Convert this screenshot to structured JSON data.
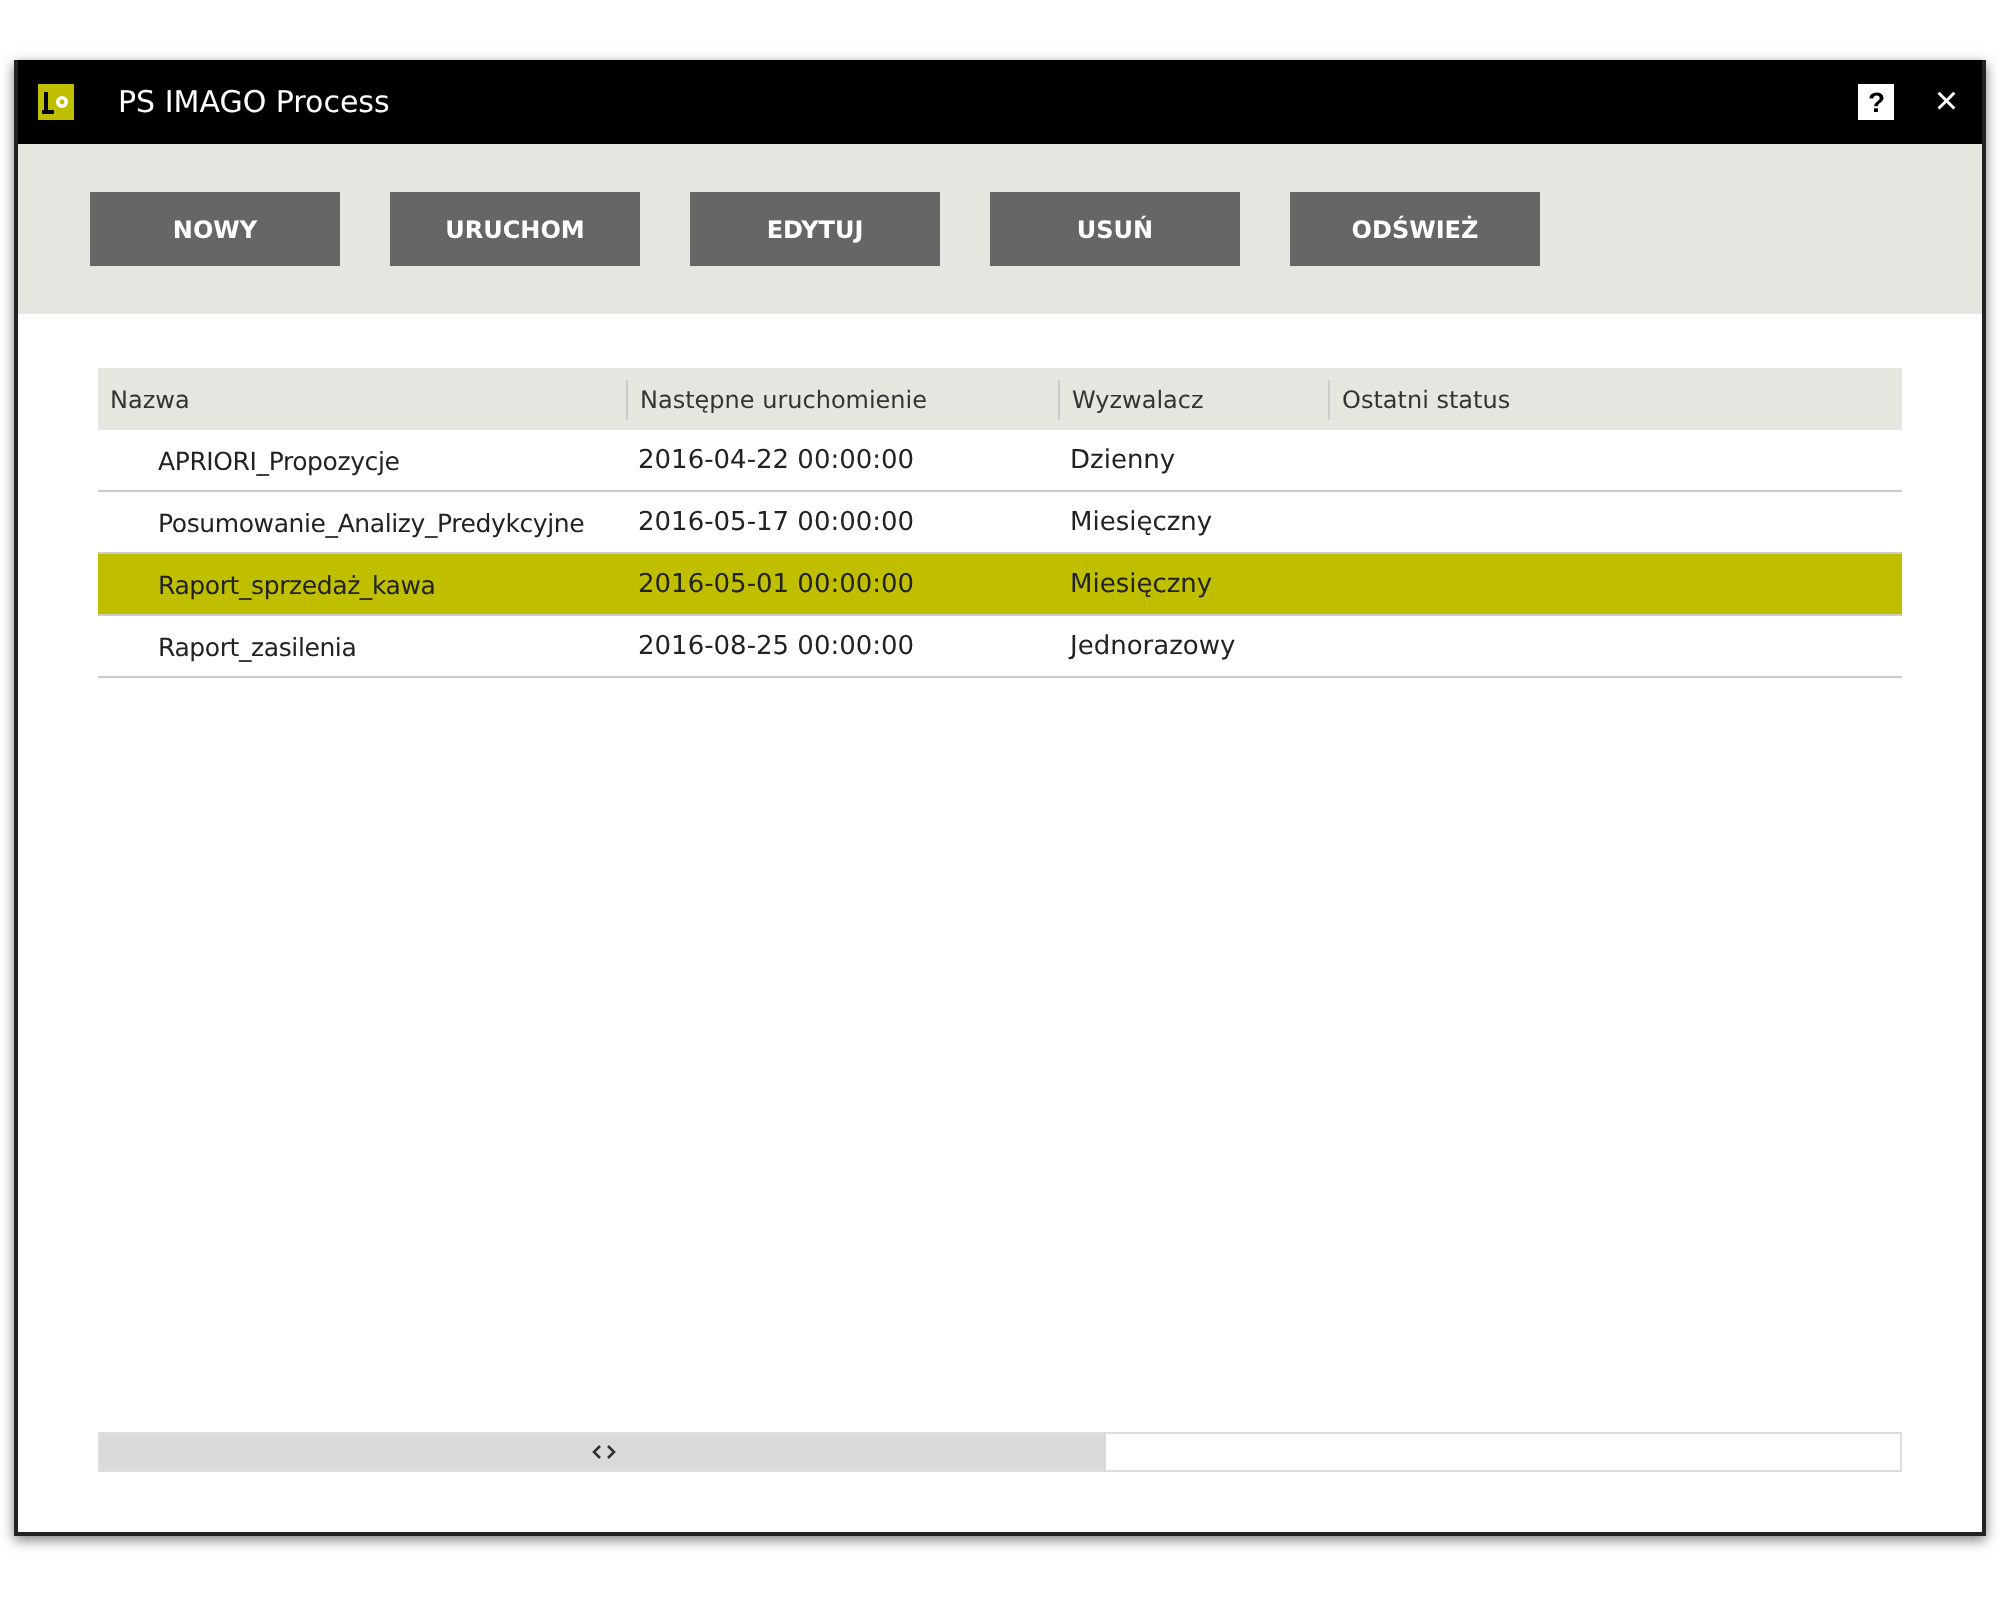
{
  "window": {
    "title": "PS IMAGO Process",
    "help": "?",
    "close": "×"
  },
  "toolbar": {
    "buttons": [
      "NOWY",
      "URUCHOM",
      "EDYTUJ",
      "USUŃ",
      "ODŚWIEŻ"
    ]
  },
  "table": {
    "columns": [
      "Nazwa",
      "Następne uruchomienie",
      "Wyzwalacz",
      "Ostatni status"
    ],
    "rows": [
      {
        "cells": [
          "APRIORI_Propozycje",
          "2016-04-22 00:00:00",
          "Dzienny"
        ],
        "selected": false
      },
      {
        "cells": [
          "Posumowanie_Analizy_Predykcyjne",
          "2016-05-17 00:00:00",
          "Miesięczny"
        ],
        "selected": false
      },
      {
        "cells": [
          "Raport_sprzedaż_kawa",
          "2016-05-01 00:00:00",
          "Miesięczny"
        ],
        "selected": true
      },
      {
        "cells": [
          "Raport_zasilenia",
          "2016-08-25 00:00:00",
          "Jednorazowy"
        ],
        "selected": false
      }
    ]
  }
}
